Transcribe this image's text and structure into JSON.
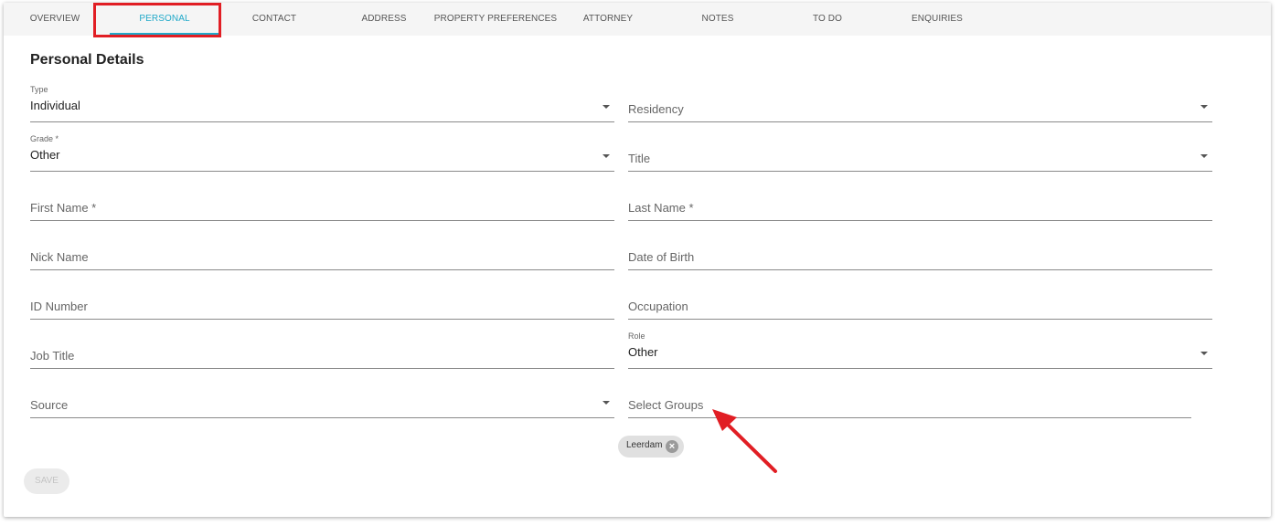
{
  "tabs": [
    {
      "label": "OVERVIEW"
    },
    {
      "label": "PERSONAL"
    },
    {
      "label": "CONTACT"
    },
    {
      "label": "ADDRESS"
    },
    {
      "label": "PROPERTY PREFERENCES"
    },
    {
      "label": "ATTORNEY"
    },
    {
      "label": "NOTES"
    },
    {
      "label": "TO DO"
    },
    {
      "label": "ENQUIRIES"
    }
  ],
  "active_tab": "PERSONAL",
  "section_title": "Personal Details",
  "fields": {
    "type": {
      "label": "Type",
      "value": "Individual"
    },
    "residency": {
      "placeholder": "Residency"
    },
    "grade": {
      "label": "Grade *",
      "value": "Other"
    },
    "title": {
      "placeholder": "Title"
    },
    "first_name": {
      "placeholder": "First Name *"
    },
    "last_name": {
      "placeholder": "Last Name *"
    },
    "nick_name": {
      "placeholder": "Nick Name"
    },
    "date_of_birth": {
      "placeholder": "Date of Birth"
    },
    "id_number": {
      "placeholder": "ID Number"
    },
    "occupation": {
      "placeholder": "Occupation"
    },
    "job_title": {
      "placeholder": "Job Title"
    },
    "role": {
      "label": "Role",
      "value": "Other"
    },
    "source": {
      "placeholder": "Source"
    },
    "groups": {
      "placeholder": "Select Groups"
    }
  },
  "group_chips": [
    {
      "label": "Leerdam",
      "icon": "close-circle-icon"
    }
  ],
  "save_label": "SAVE",
  "colors": {
    "accent": "#21a9c9",
    "highlight": "#e11e24",
    "annotation_arrow": "#e11e24"
  }
}
